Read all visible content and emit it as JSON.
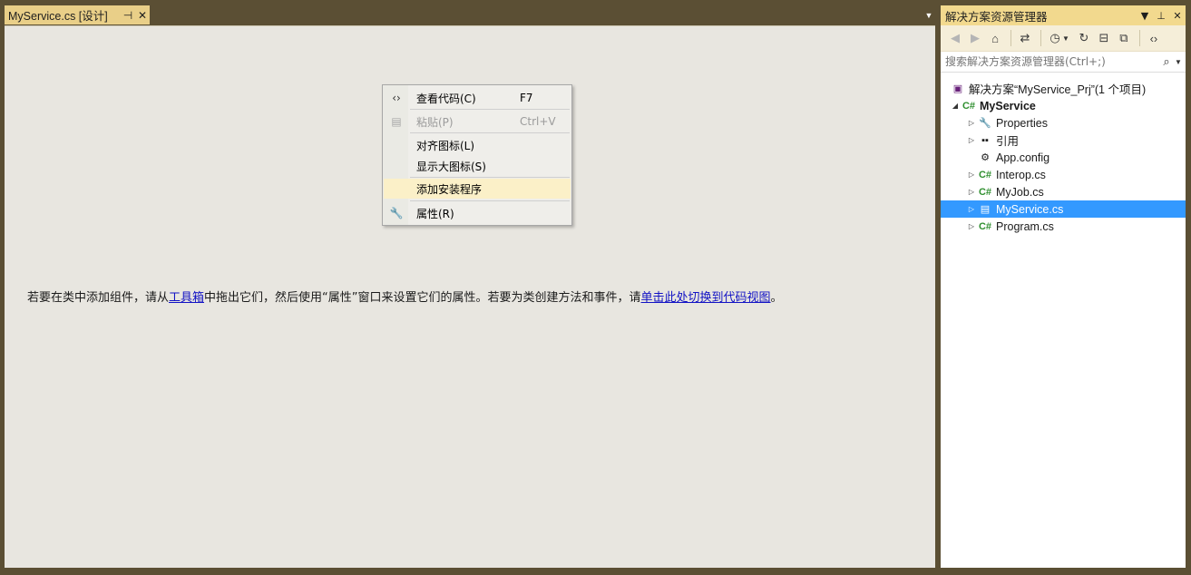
{
  "document_tab": {
    "title": "MyService.cs [设计]",
    "pin_icon": "pin-icon",
    "close_icon": "close-icon"
  },
  "designer": {
    "hint_pre": "若要在类中添加组件，请从",
    "hint_link1": "工具箱",
    "hint_mid": "中拖出它们，然后使用“属性”窗口来设置它们的属性。若要为类创建方法和事件，请",
    "hint_link2": "单击此处切换到代码视图",
    "hint_post": "。"
  },
  "context_menu": {
    "items": [
      {
        "label": "查看代码(C)",
        "shortcut": "F7",
        "icon": "code-view-icon",
        "enabled": true
      },
      {
        "label": "粘贴(P)",
        "shortcut": "Ctrl+V",
        "icon": "paste-icon",
        "enabled": false
      },
      {
        "label": "对齐图标(L)",
        "shortcut": "",
        "icon": "",
        "enabled": true
      },
      {
        "label": "显示大图标(S)",
        "shortcut": "",
        "icon": "",
        "enabled": true
      },
      {
        "label": "添加安装程序",
        "shortcut": "",
        "icon": "",
        "enabled": true,
        "highlighted": true
      },
      {
        "label": "属性(R)",
        "shortcut": "",
        "icon": "wrench-icon",
        "enabled": true
      }
    ]
  },
  "solution_explorer": {
    "title": "解决方案资源管理器",
    "search_placeholder": "搜索解决方案资源管理器(Ctrl+;)",
    "tree": [
      {
        "label": "解决方案“MyService_Prj”(1 个项目)",
        "icon": "solution-icon",
        "level": 0,
        "expand": "none"
      },
      {
        "label": "MyService",
        "icon": "csharp-project-icon",
        "level": 0,
        "expand": "expanded",
        "bold": true
      },
      {
        "label": "Properties",
        "icon": "wrench-icon",
        "level": 1,
        "expand": "collapsed"
      },
      {
        "label": "引用",
        "icon": "references-icon",
        "level": 1,
        "expand": "collapsed"
      },
      {
        "label": "App.config",
        "icon": "config-file-icon",
        "level": 1,
        "expand": "none"
      },
      {
        "label": "Interop.cs",
        "icon": "csharp-file-icon",
        "level": 1,
        "expand": "collapsed"
      },
      {
        "label": "MyJob.cs",
        "icon": "csharp-file-icon",
        "level": 1,
        "expand": "collapsed"
      },
      {
        "label": "MyService.cs",
        "icon": "service-file-icon",
        "level": 1,
        "expand": "collapsed",
        "selected": true
      },
      {
        "label": "Program.cs",
        "icon": "csharp-file-icon",
        "level": 1,
        "expand": "collapsed"
      }
    ]
  },
  "colors": {
    "frame": "#5b4f34",
    "active_tab": "#e9cf88",
    "designer_bg": "#e8e6e0",
    "selection": "#3399ff",
    "menu_highlight": "#fbf0c8"
  }
}
